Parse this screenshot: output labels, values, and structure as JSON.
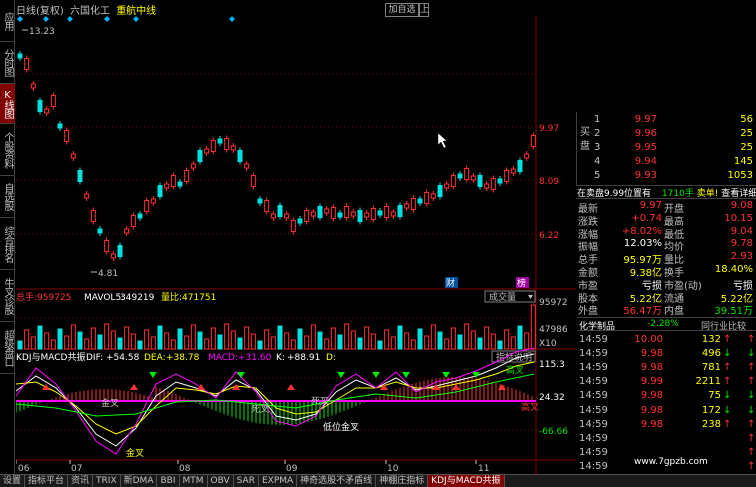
{
  "left_tabs": [
    {
      "label": "应用"
    },
    {
      "label": "分时图"
    },
    {
      "label": "K线图"
    },
    {
      "label": "个股资料"
    },
    {
      "label": "自选股"
    },
    {
      "label": "综合排名"
    },
    {
      "label": "牛叉诊股"
    },
    {
      "label": "超级盘口"
    }
  ],
  "title": {
    "period": "日线(复权)",
    "stock_name": "六国化工",
    "indicator": "重航中线"
  },
  "add_self_label": "加自选",
  "prev_label": "上",
  "main_chart": {
    "high_label": "13.23",
    "low_label": "4.81",
    "y_ticks": [
      "9.97",
      "8.09",
      "6.22"
    ],
    "markers": [
      "财",
      "榜"
    ]
  },
  "volume_panel": {
    "total_hand_label": "总手:",
    "total_hand": "959725",
    "mavol5_label": "MAVOL5:",
    "mavol5": "349219",
    "ratio_label": "量比:",
    "ratio": "471751",
    "dropdown": "成交量",
    "y_ticks": [
      "95972",
      "47986",
      "X10"
    ]
  },
  "kdj_panel": {
    "name": "KDJ与MACD共振",
    "dif_label": "DIF:",
    "dif": "+54.58",
    "dea_label": "DEA:",
    "dea": "+38.78",
    "macd_label": "MACD:",
    "macd": "+31.60",
    "k_label": "K:",
    "k": "+88.91",
    "d_label": "D:",
    "explain_button": "指标说明",
    "y_ticks": [
      "115.3",
      "24.32",
      "-66.66"
    ],
    "annotations": [
      "金叉",
      "死叉",
      "死叉",
      "低位金叉",
      "高叉",
      "高叉"
    ],
    "buy_sell": [
      "买"
    ]
  },
  "x_axis": [
    "06",
    "07",
    "08",
    "09",
    "10",
    "11"
  ],
  "order_book": {
    "side_buy": "买盘",
    "levels": [
      {
        "n": "1",
        "price": "9.97",
        "vol": "56"
      },
      {
        "n": "2",
        "price": "9.96",
        "vol": "25"
      },
      {
        "n": "3",
        "price": "9.95",
        "vol": "25"
      },
      {
        "n": "4",
        "price": "9.94",
        "vol": "145"
      },
      {
        "n": "5",
        "price": "9.93",
        "vol": "1053"
      }
    ],
    "notice_left": "在卖盘9.99位置有",
    "notice_qty": "1710手",
    "notice_action": "卖单!",
    "notice_link": "查看详细"
  },
  "quote": [
    {
      "l1": "最新",
      "v1": "9.97",
      "c1": "red",
      "l2": "开盘",
      "v2": "9.08",
      "c2": "red"
    },
    {
      "l1": "涨跌",
      "v1": "+0.74",
      "c1": "red",
      "l2": "最高",
      "v2": "10.15",
      "c2": "red"
    },
    {
      "l1": "涨幅",
      "v1": "+8.02%",
      "c1": "red",
      "l2": "最低",
      "v2": "9.04",
      "c2": "red"
    },
    {
      "l1": "振幅",
      "v1": "12.03%",
      "c1": "white",
      "l2": "均价",
      "v2": "9.78",
      "c2": "red"
    },
    {
      "l1": "总手",
      "v1": "95.97万",
      "c1": "yellow",
      "l2": "量比",
      "v2": "2.93",
      "c2": "red"
    },
    {
      "l1": "金额",
      "v1": "9.38亿",
      "c1": "yellow",
      "l2": "换手",
      "v2": "18.40%",
      "c2": "yellow"
    },
    {
      "l1": "市盈",
      "v1": "亏损",
      "c1": "white",
      "l2": "市盈(动)",
      "v2": "亏损",
      "c2": "white"
    },
    {
      "l1": "股本",
      "v1": "5.22亿",
      "c1": "yellow",
      "l2": "流通",
      "v2": "5.22亿",
      "c2": "yellow"
    },
    {
      "l1": "外盘",
      "v1": "56.47万",
      "c1": "red",
      "l2": "内盘",
      "v2": "39.51万",
      "c2": "green"
    }
  ],
  "sector": {
    "name": "化学制品",
    "change": "-2.28%",
    "button": "同行业比较"
  },
  "ticks": [
    {
      "t": "14:59",
      "p": "10.00",
      "v": "132",
      "dir": "up"
    },
    {
      "t": "14:59",
      "p": "9.98",
      "v": "496",
      "dir": "down"
    },
    {
      "t": "14:59",
      "p": "9.98",
      "v": "781",
      "dir": "up"
    },
    {
      "t": "14:59",
      "p": "9.99",
      "v": "2211",
      "dir": "up"
    },
    {
      "t": "14:59",
      "p": "9.98",
      "v": "75",
      "dir": "down"
    },
    {
      "t": "14:59",
      "p": "9.98",
      "v": "172",
      "dir": "down"
    },
    {
      "t": "14:59",
      "p": "9.98",
      "v": "238",
      "dir": "up"
    },
    {
      "t": "14:59",
      "p": "",
      "v": "",
      "dir": "up"
    },
    {
      "t": "14:59",
      "p": "",
      "v": "",
      "dir": "up"
    },
    {
      "t": "14:59",
      "p": "",
      "v": "",
      "dir": "up"
    }
  ],
  "watermark": "www.7gpzb.com",
  "bottom_tabs": [
    "设置",
    "指标平台",
    "资讯",
    "TRIX",
    "新DMA",
    "BBI",
    "MTM",
    "OBV",
    "SAR",
    "EXPMA",
    "神奇选股不矛盾线",
    "神棚庄指标",
    "KDJ与MACD共振"
  ],
  "colors": {
    "up": "#ff3232",
    "down": "#00e0e0",
    "bg": "#000000",
    "active_tab": "#800000"
  }
}
